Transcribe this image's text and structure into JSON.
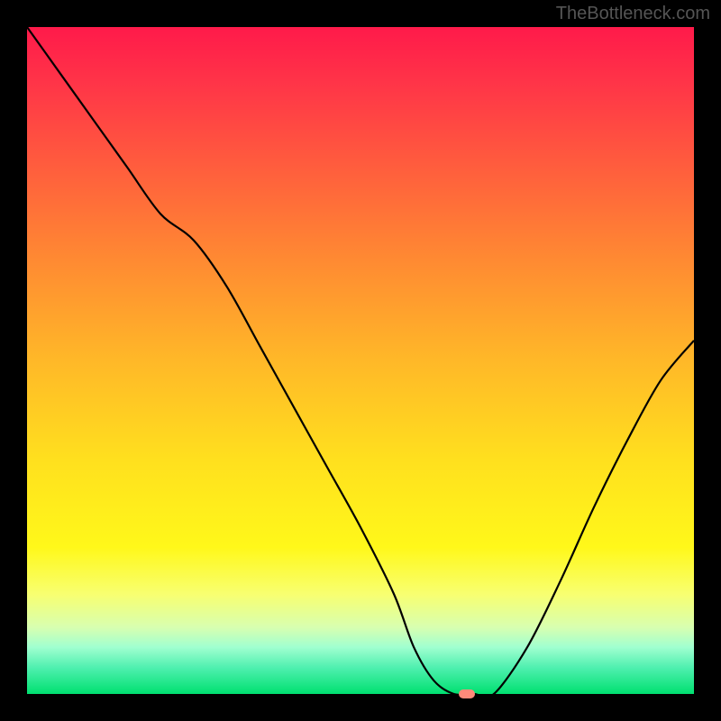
{
  "watermark": "TheBottleneck.com",
  "chart_data": {
    "type": "line",
    "title": "",
    "xlabel": "",
    "ylabel": "",
    "xlim": [
      0,
      100
    ],
    "ylim": [
      0,
      100
    ],
    "x": [
      0,
      5,
      10,
      15,
      20,
      25,
      30,
      35,
      40,
      45,
      50,
      55,
      58,
      61,
      64,
      67,
      70,
      75,
      80,
      85,
      90,
      95,
      100
    ],
    "y": [
      100,
      93,
      86,
      79,
      72,
      68,
      61,
      52,
      43,
      34,
      25,
      15,
      7,
      2,
      0,
      0,
      0,
      7,
      17,
      28,
      38,
      47,
      53
    ],
    "marker": {
      "x": 66,
      "y": 0
    },
    "background_gradient": [
      "#ff1a4a",
      "#ffb828",
      "#fff81a",
      "#00e070"
    ]
  }
}
